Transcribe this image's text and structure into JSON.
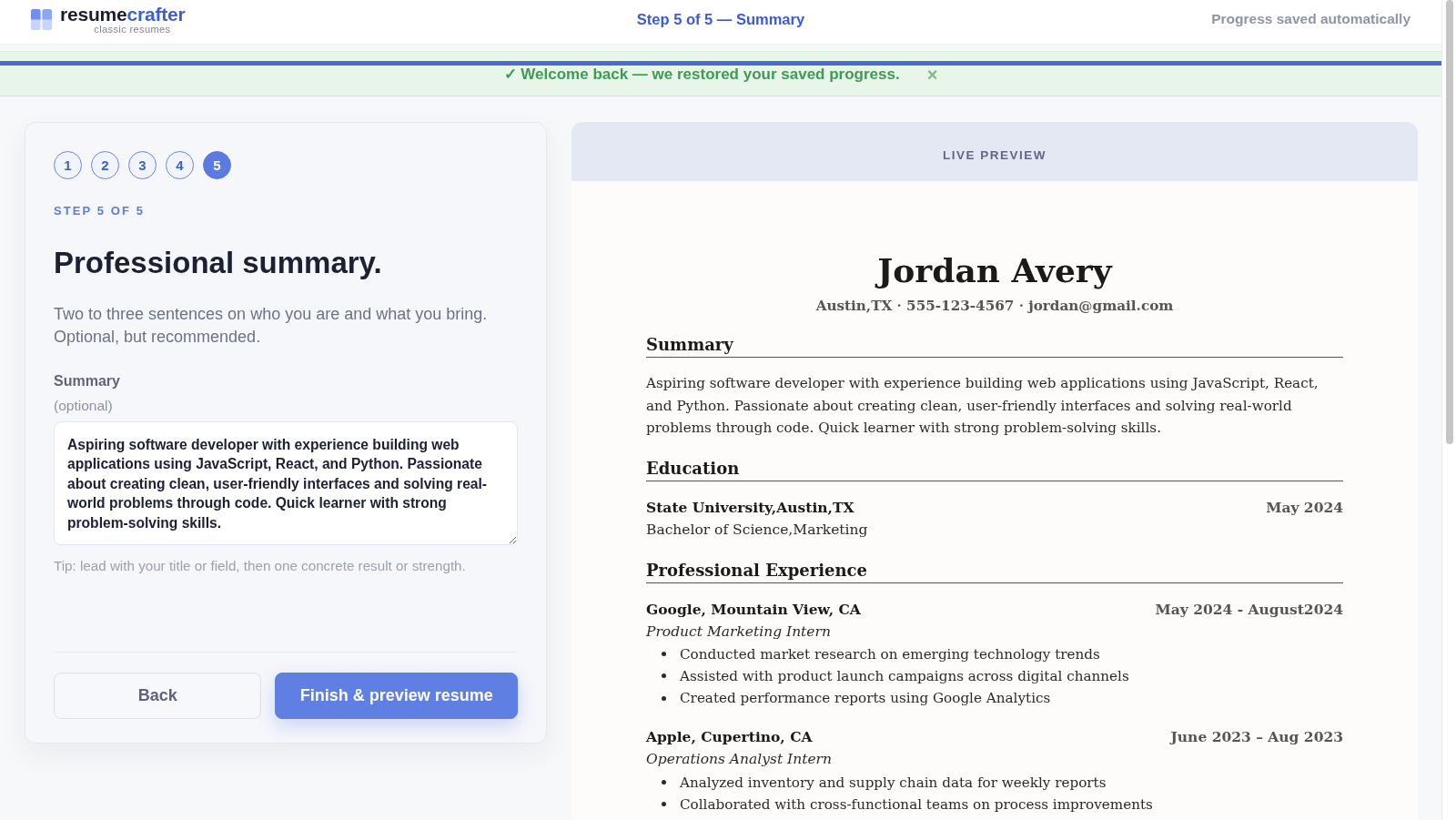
{
  "header": {
    "logo": {
      "name_dark": "resume",
      "name_accent": "crafter",
      "tagline": "classic resumes"
    },
    "step_title": "Step 5 of 5 — Summary",
    "save_status": "Progress saved automatically"
  },
  "progress": {
    "level": 1
  },
  "banner": {
    "message": "✓ Welcome back — we restored your saved progress.",
    "close": "×"
  },
  "wizard": {
    "steps": [
      {
        "label": "1",
        "selected": false
      },
      {
        "label": "2",
        "selected": false
      },
      {
        "label": "3",
        "selected": false
      },
      {
        "label": "4",
        "selected": false
      },
      {
        "label": "5",
        "selected": true
      }
    ],
    "step_caption": "STEP 5 OF 5",
    "heading": "Professional summary.",
    "description": "Two to three sentences on who you are and what you bring. Optional, but recommended.",
    "field": {
      "label": "Summary",
      "hint": "(optional)",
      "value": "Aspiring software developer with experience building web applications using JavaScript, React, and Python. Passionate about creating clean, user-friendly interfaces and solving real-world problems through code. Quick learner with strong problem-solving skills.",
      "tip": "Tip: lead with your title or field, then one concrete result or strength."
    },
    "buttons": [
      {
        "label": "Back",
        "kind": "secondary"
      },
      {
        "label": "Finish & preview resume",
        "kind": "primary"
      }
    ]
  },
  "preview": {
    "title": "LIVE PREVIEW",
    "resume": {
      "name": "Jordan Avery",
      "contact": "Austin,TX · 555-123-4567 · jordan@gmail.com",
      "sections": [
        {
          "kind": "text",
          "heading": "Summary",
          "text": "Aspiring software developer with experience building web applications using JavaScript, React, and Python. Passionate about creating clean, user-friendly interfaces and solving real-world problems through code. Quick learner with strong problem-solving skills."
        },
        {
          "kind": "entries",
          "heading": "Education",
          "entries": [
            {
              "title": "State University,Austin,TX",
              "date": "May 2024",
              "detail": "Bachelor of Science,Marketing"
            }
          ]
        },
        {
          "kind": "entries",
          "heading": "Professional Experience",
          "entries": [
            {
              "title": "Google, Mountain View, CA",
              "date": "May 2024 - August2024",
              "role": "Product Marketing Intern",
              "bullets": [
                "Conducted market research on emerging technology trends",
                "Assisted with product launch campaigns across digital channels",
                "Created performance reports using Google Analytics"
              ]
            },
            {
              "title": "Apple, Cupertino, CA",
              "date": "June 2023 – Aug 2023",
              "role": "Operations Analyst Intern",
              "bullets": [
                "Analyzed inventory and supply chain data for weekly reports",
                "Collaborated with cross-functional teams on process improvements"
              ]
            }
          ]
        }
      ]
    }
  }
}
